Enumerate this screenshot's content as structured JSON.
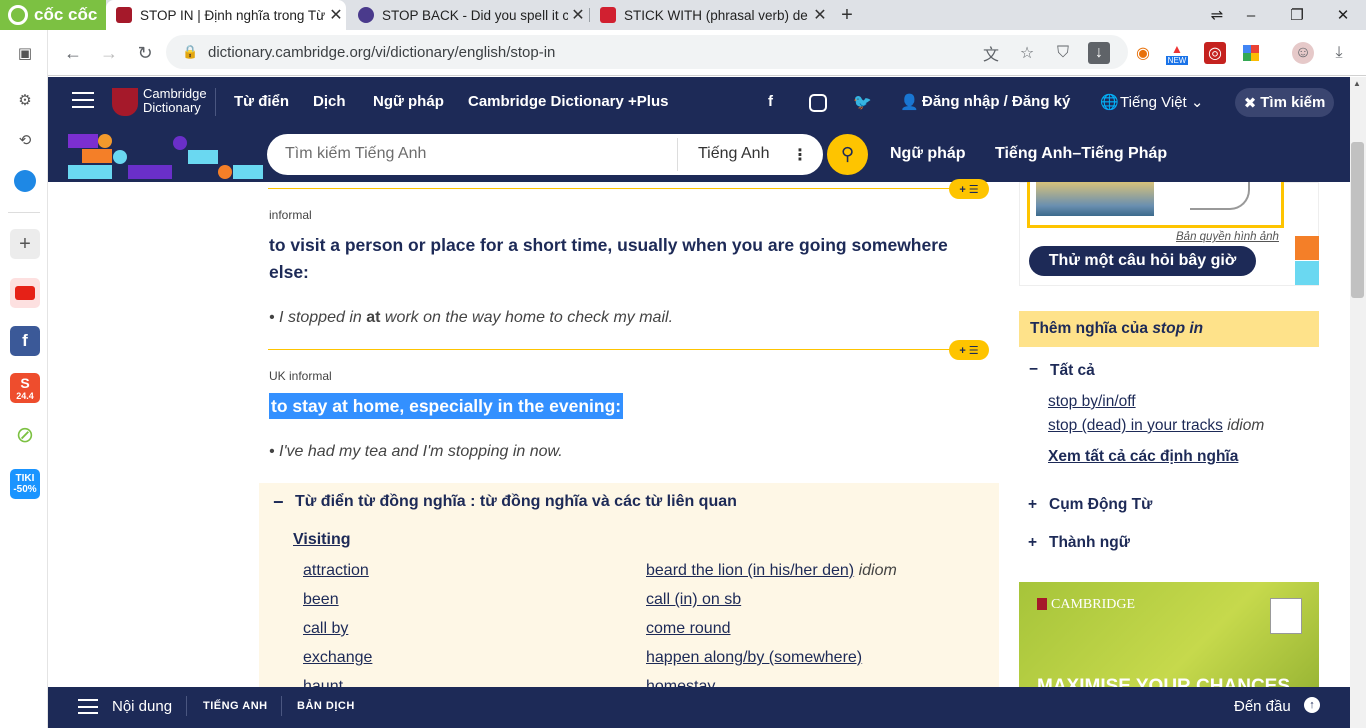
{
  "browser": {
    "logo_label": "cốc cốc",
    "tabs": [
      {
        "title": "STOP IN | Định nghĩa trong Từ",
        "active": true
      },
      {
        "title": "STOP BACK - Did you spell it c",
        "active": false
      },
      {
        "title": "STICK WITH (phrasal verb) de",
        "active": false
      }
    ],
    "new_tab": "+",
    "url": "dictionary.cambridge.org/vi/dictionary/english/stop-in",
    "sidebar_badge_shop": "24.4",
    "sidebar_badge_tiki": "TIKI\n-50%",
    "ext_new_badge": "NEW"
  },
  "site": {
    "logo_line1": "Cambridge",
    "logo_line2": "Dictionary",
    "nav": [
      "Từ điển",
      "Dịch",
      "Ngữ pháp",
      "Cambridge Dictionary +Plus"
    ],
    "login": "Đăng nhập / Đăng ký",
    "language": "Tiếng Việt",
    "search_button": "Tìm kiếm",
    "search_placeholder": "Tìm kiếm Tiếng Anh",
    "search_lang": "Tiếng Anh",
    "sub_links": [
      "Ngữ pháp",
      "Tiếng Anh–Tiếng Pháp"
    ]
  },
  "entry": {
    "sense1": {
      "label": "informal",
      "definition": "to visit a person or place for a short time, usually when you are going somewhere else:",
      "example_pre": "I stopped in ",
      "example_bold": "at",
      "example_post": " work on the way home to check my mail."
    },
    "sense2": {
      "label": "UK informal",
      "definition": "to stay at home, especially in the evening:",
      "example": "I've had my tea and I'm stopping in now."
    },
    "thesaurus": {
      "heading": "Từ điển từ đồng nghĩa : từ đồng nghĩa và các từ liên quan",
      "group": "Visiting",
      "left": [
        "attraction",
        "been",
        "call by",
        "exchange",
        "haunt"
      ],
      "right": [
        {
          "text": "beard the lion (in his/her den)",
          "tag": "idiom"
        },
        {
          "text": "call (in) on sb",
          "tag": ""
        },
        {
          "text": "come round",
          "tag": ""
        },
        {
          "text": "happen along/by (somewhere)",
          "tag": ""
        },
        {
          "text": "homestay",
          "tag": ""
        }
      ]
    },
    "plus_label": "+ ☰"
  },
  "sidebar_right": {
    "image_credit": "Bản quyền hình ảnh",
    "try_button": "Thử một câu hỏi bây giờ",
    "more_prefix": "Thêm nghĩa của ",
    "more_term": "stop in",
    "all_label": "Tất cả",
    "links": [
      {
        "text": "stop by/in/off",
        "tag": ""
      },
      {
        "text": "stop (dead) in your tracks",
        "tag": "idiom"
      }
    ],
    "see_all": "Xem tất cả các định nghĩa",
    "phrasal": "Cụm Động Từ",
    "idioms": "Thành ngữ",
    "ad_brand": "CAMBRIDGE",
    "ad_text": "MAXIMISE YOUR CHANCES"
  },
  "bottom_bar": {
    "contents": "Nội dung",
    "tab1": "TIẾNG ANH",
    "tab2": "BẢN DỊCH",
    "top": "Đến đầu"
  }
}
